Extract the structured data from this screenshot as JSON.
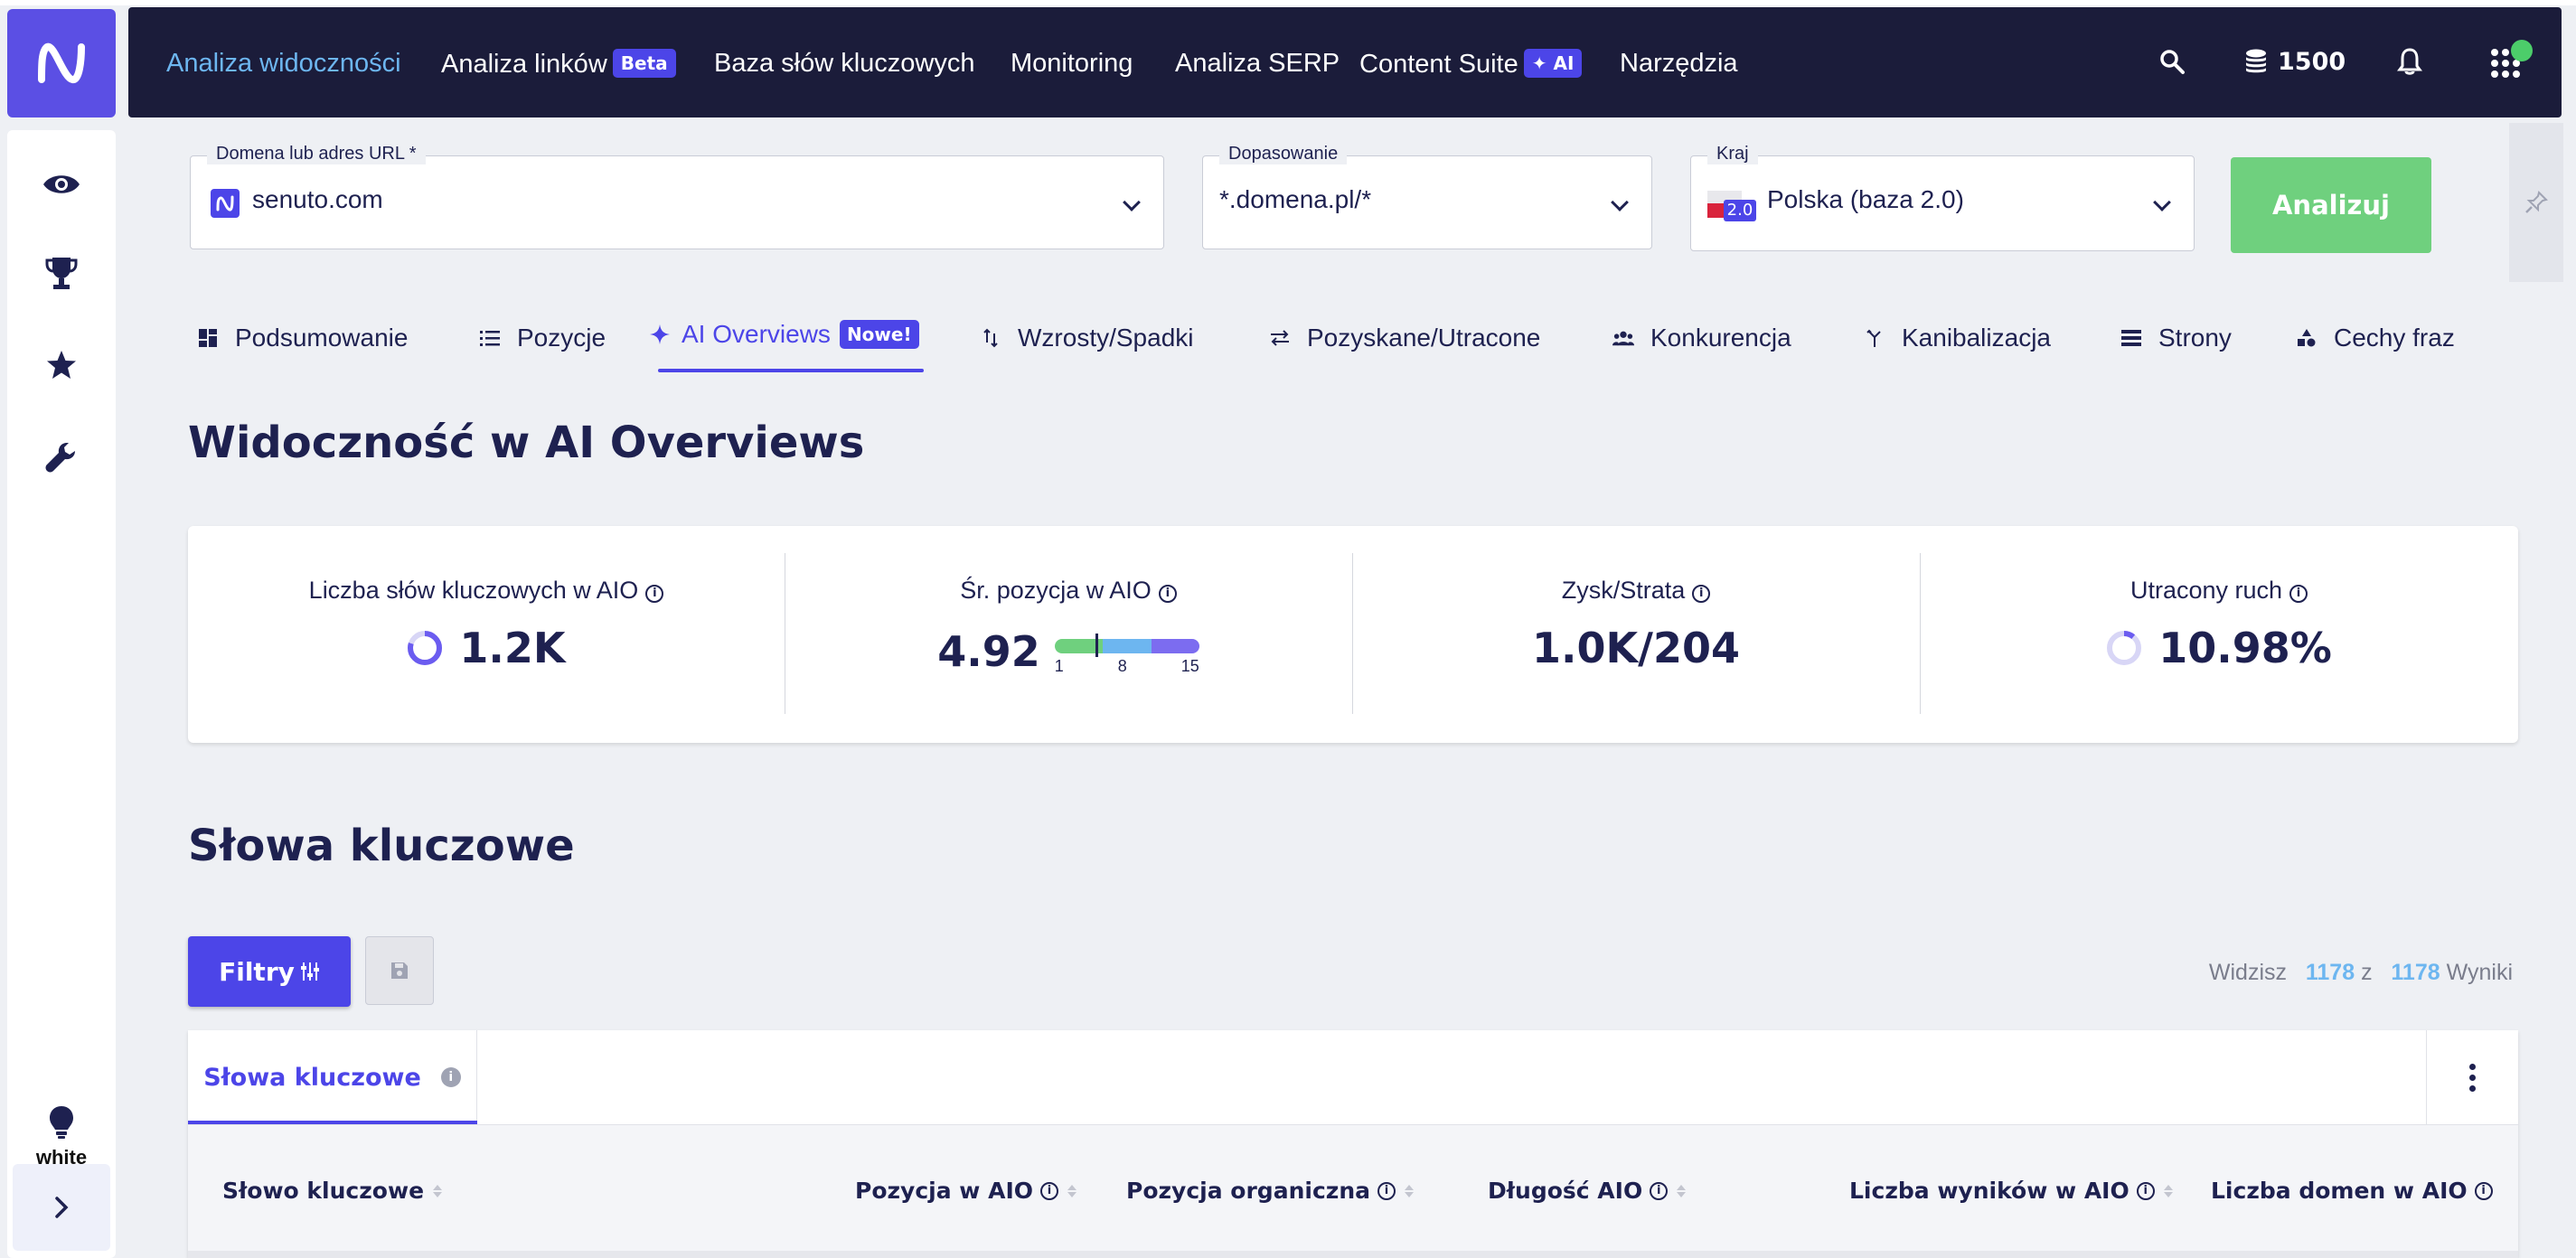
{
  "nav": {
    "items": [
      "Analiza widoczności",
      "Analiza linków",
      "Baza słów kluczowych",
      "Monitoring",
      "Analiza SERP",
      "Content Suite",
      "Narzędzia"
    ],
    "links_badge": "Beta",
    "content_badge": "AI",
    "credits": "1500",
    "active_color": "#6db6f0"
  },
  "search": {
    "domain_label": "Domena lub adres URL *",
    "domain_value": "senuto.com",
    "match_label": "Dopasowanie",
    "match_value": "*.domena.pl/*",
    "country_label": "Kraj",
    "country_value": "Polska (baza 2.0)",
    "country_flag_badge": "2.0",
    "analyze_label": "Analizuj"
  },
  "tabs": {
    "items": [
      "Podsumowanie",
      "Pozycje",
      "AI Overviews",
      "Wzrosty/Spadki",
      "Pozyskane/Utracone",
      "Konkurencja",
      "Kanibalizacja",
      "Strony",
      "Cechy fraz"
    ],
    "ai_badge": "Nowe!",
    "active": "AI Overviews"
  },
  "visibility": {
    "title": "Widoczność w AI Overviews",
    "metrics": [
      {
        "label": "Liczba słów kluczowych w AIO",
        "value": "1.2K",
        "ring_fraction": 0.8
      },
      {
        "label": "Śr. pozycja w AIO",
        "value": "4.92",
        "scale_min": "1",
        "scale_mid": "8",
        "scale_max": "15",
        "marker": 4.92
      },
      {
        "label": "Zysk/Strata",
        "value": "1.0K/204"
      },
      {
        "label": "Utracony ruch",
        "value": "10.98%",
        "ring_fraction": 0.11
      }
    ]
  },
  "keywords": {
    "title": "Słowa kluczowe",
    "filters_label": "Filtry",
    "results_prefix": "Widzisz",
    "results_shown": "1178",
    "results_mid": "z",
    "results_total": "1178",
    "results_suffix": "Wyniki",
    "subtab_label": "Słowa kluczowe",
    "columns": [
      "Słowo kluczowe",
      "Pozycja w AIO",
      "Pozycja organiczna",
      "Długość AIO",
      "Liczba wyników w AIO",
      "Liczba domen w AIO"
    ]
  },
  "colors": {
    "brand": "#5b4fe4",
    "accent": "#4c45e8",
    "navy": "#1b1c3a",
    "analyze": "#6fd07e",
    "online_dot": "#4ccd6a"
  }
}
